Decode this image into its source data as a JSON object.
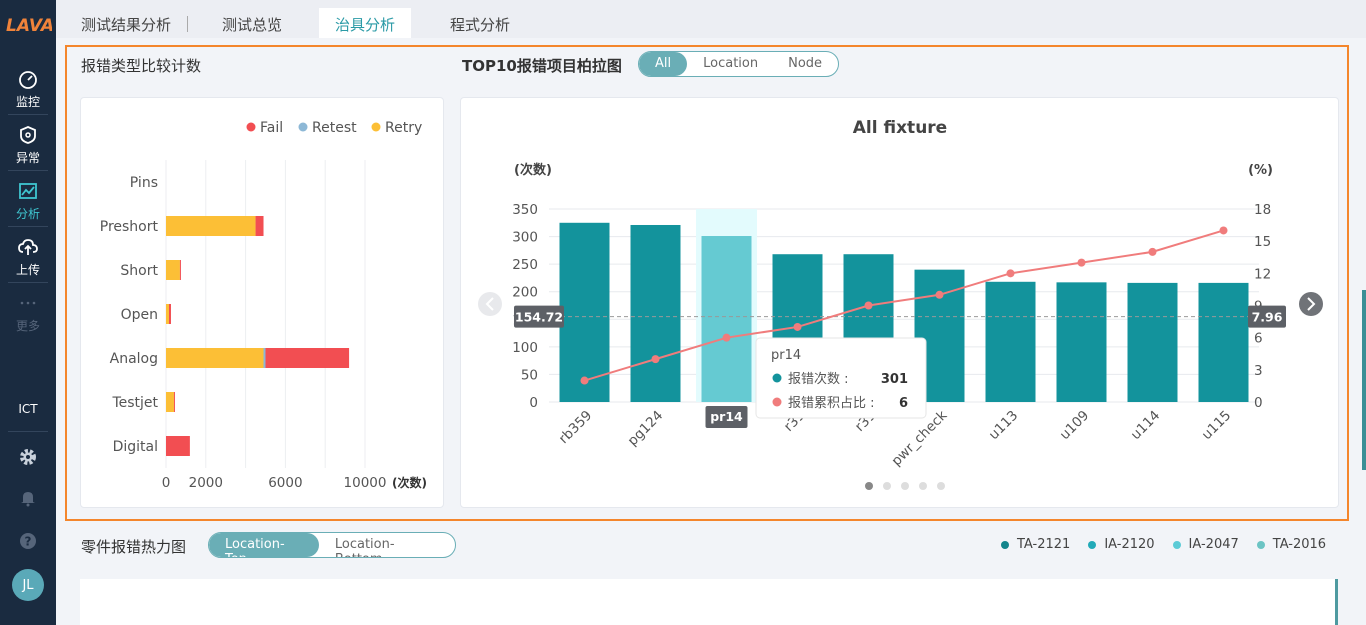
{
  "sidebar": {
    "logo_text": "LAVA",
    "items": [
      {
        "label": "监控",
        "icon": "gauge-icon"
      },
      {
        "label": "异常",
        "icon": "shield-alert-icon"
      },
      {
        "label": "分析",
        "icon": "chart-line-icon"
      },
      {
        "label": "上传",
        "icon": "cloud-upload-icon"
      },
      {
        "label": "更多",
        "icon": "more-dots-icon"
      }
    ],
    "ict_label": "ICT",
    "avatar_initials": "JL"
  },
  "tabs": [
    {
      "label": "测试结果分析"
    },
    {
      "label": "测试总览"
    },
    {
      "label": "治具分析"
    },
    {
      "label": "程式分析"
    }
  ],
  "active_tab": "治具分析",
  "left_panel": {
    "title": "报错类型比较计数",
    "legend": [
      {
        "name": "Fail",
        "color": "#f24e52"
      },
      {
        "name": "Retest",
        "color": "#8db8d6"
      },
      {
        "name": "Retry",
        "color": "#fcbf36"
      }
    ]
  },
  "right_panel": {
    "title": "TOP10报错项目柏拉图",
    "filters": [
      "All",
      "Location",
      "Node"
    ],
    "active_filter": "All"
  },
  "heatmap_section": {
    "title": "零件报错热力图",
    "filters": [
      "Location-Top",
      "Location-Bottom"
    ],
    "active_filter": "Location-Top",
    "legend": [
      {
        "name": "TA-2121",
        "color": "#13858c"
      },
      {
        "name": "IA-2120",
        "color": "#22aab8"
      },
      {
        "name": "IA-2047",
        "color": "#5ccbd6"
      },
      {
        "name": "TA-2016",
        "color": "#6cc4c4"
      }
    ]
  },
  "chart_data": [
    {
      "type": "bar",
      "orientation": "horizontal",
      "stacked": true,
      "categories": [
        "Pins",
        "Preshort",
        "Short",
        "Open",
        "Analog",
        "Testjet",
        "Digital"
      ],
      "series": [
        {
          "name": "Retry",
          "color": "#fcbf36",
          "values": [
            0,
            4500,
            700,
            150,
            4900,
            400,
            0
          ]
        },
        {
          "name": "Retest",
          "color": "#8db8d6",
          "values": [
            0,
            0,
            0,
            0,
            100,
            0,
            0
          ]
        },
        {
          "name": "Fail",
          "color": "#f24e52",
          "values": [
            0,
            400,
            50,
            100,
            4200,
            50,
            1200
          ]
        }
      ],
      "x_ticks": [
        "0",
        "2000",
        "6000",
        "10000"
      ],
      "x_tick_values": [
        0,
        2000,
        6000,
        10000
      ],
      "xlim": [
        0,
        10000
      ],
      "xlabel": "(次数)",
      "legend_position": "top-right",
      "grid": true
    },
    {
      "type": "bar",
      "title": "All fixture",
      "categories": [
        "rb359",
        "pg124",
        "pr14",
        "r31",
        "r31",
        "pwr_check",
        "u113",
        "u109",
        "u114",
        "u115"
      ],
      "category_labels": [
        "rb359",
        "pg124",
        "p",
        "r31",
        "r31",
        "pwr_check",
        "u113",
        "u109",
        "u114",
        "u115"
      ],
      "series": [
        {
          "name": "报错次数",
          "type": "bar",
          "axis": "left",
          "color": "#13939c",
          "values": [
            325,
            321,
            301,
            268,
            268,
            240,
            218,
            217,
            216,
            216
          ]
        },
        {
          "name": "报错累积占比",
          "type": "line",
          "axis": "right",
          "color": "#f07c7c",
          "values": [
            2,
            4,
            6,
            7,
            9,
            10,
            12,
            13,
            14,
            16
          ]
        }
      ],
      "ylabel_left": "(次数)",
      "ylabel_right": "(%)",
      "ylim_left": [
        0,
        350
      ],
      "ylim_right": [
        0,
        18
      ],
      "y_ticks_left": [
        0,
        50,
        100,
        150,
        200,
        250,
        300,
        350
      ],
      "y_ticks_right": [
        0,
        3,
        6,
        9,
        12,
        15,
        18
      ],
      "crosshair": {
        "left_value": "154.72",
        "right_value": "7.96",
        "category": "pr14"
      },
      "highlight_index": 2,
      "tooltip": {
        "title": "pr14",
        "rows": [
          {
            "label": "报错次数 :",
            "value": "301"
          },
          {
            "label": "报错累积占比 :",
            "value": "6"
          }
        ]
      },
      "pagination_dots": 5,
      "active_page": 0,
      "grid": true
    }
  ]
}
